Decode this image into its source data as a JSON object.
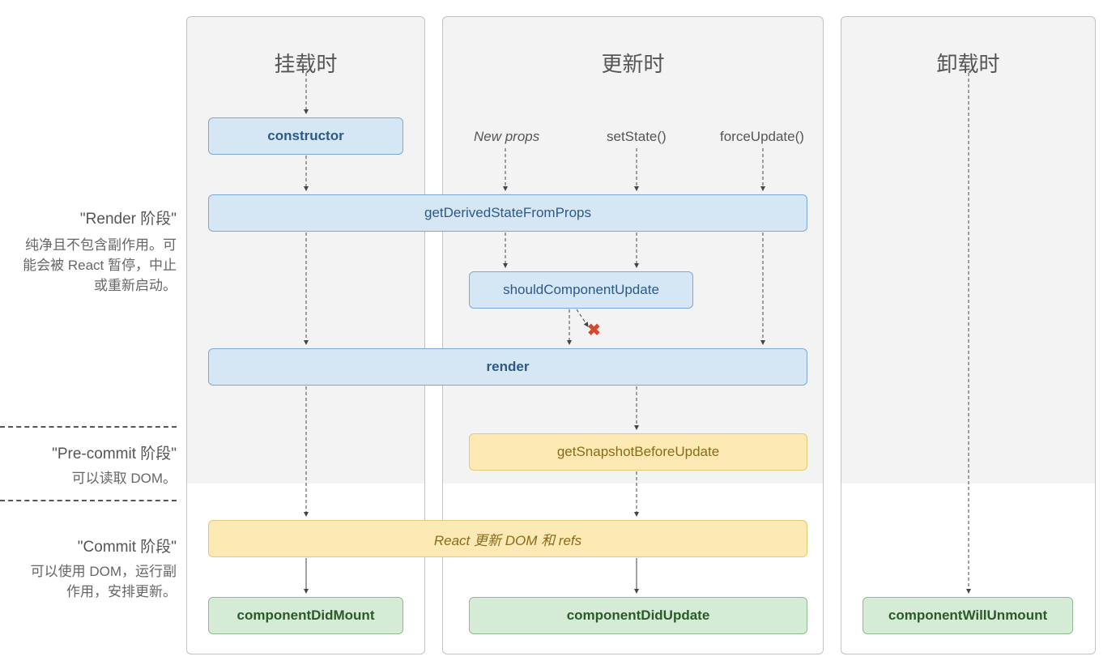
{
  "columns": {
    "mounting": "挂载时",
    "updating": "更新时",
    "unmounting": "卸载时"
  },
  "triggers": {
    "newProps": "New props",
    "setState": "setState()",
    "forceUpdate": "forceUpdate()"
  },
  "nodes": {
    "constructor": "constructor",
    "gdsfp": "getDerivedStateFromProps",
    "scu": "shouldComponentUpdate",
    "render": "render",
    "gsbu": "getSnapshotBeforeUpdate",
    "reactUpdates": "React 更新 DOM 和 refs",
    "cdm": "componentDidMount",
    "cdu": "componentDidUpdate",
    "cwu": "componentWillUnmount"
  },
  "phases": {
    "render": {
      "title": "\"Render 阶段\"",
      "desc": "纯净且不包含副作用。可能会被 React 暂停，中止或重新启动。"
    },
    "precommit": {
      "title": "\"Pre-commit 阶段\"",
      "desc": "可以读取 DOM。"
    },
    "commit": {
      "title": "\"Commit 阶段\"",
      "desc": "可以使用 DOM，运行副作用，安排更新。"
    }
  }
}
